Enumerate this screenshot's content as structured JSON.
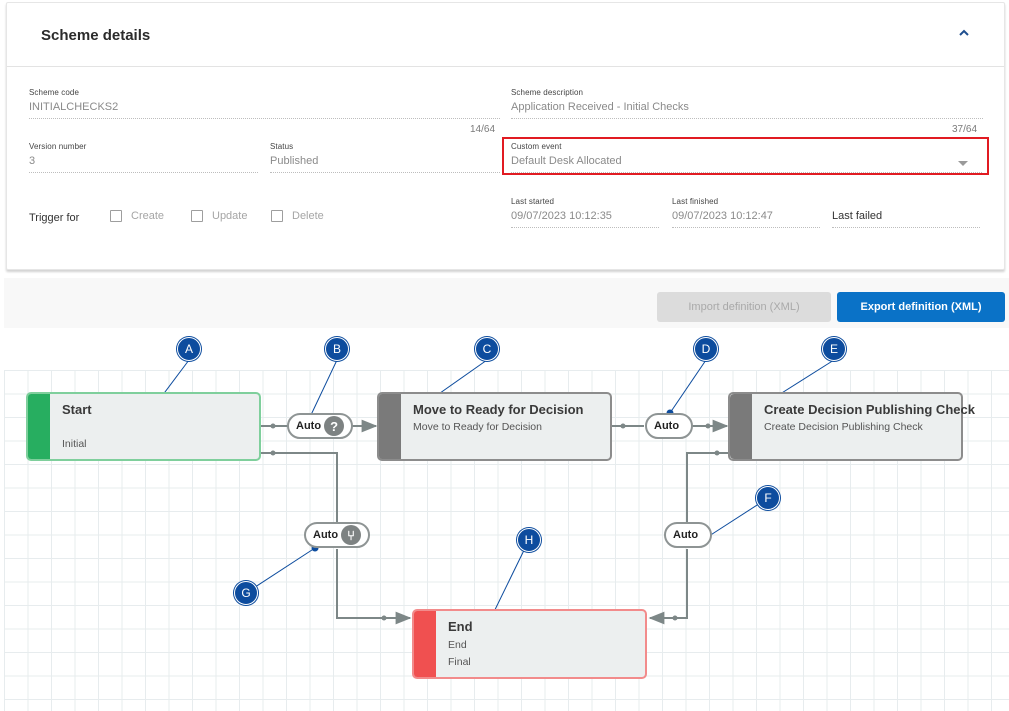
{
  "scheme_details": {
    "title": "Scheme details",
    "collapse_icon": "chevron-up-icon",
    "scheme_code": {
      "label": "Scheme code",
      "value": "INITIALCHECKS2",
      "counter": "14/64"
    },
    "scheme_description": {
      "label": "Scheme description",
      "value": "Application Received - Initial Checks",
      "counter": "37/64"
    },
    "version_number": {
      "label": "Version number",
      "value": "3"
    },
    "status": {
      "label": "Status",
      "value": "Published"
    },
    "custom_event": {
      "label": "Custom event",
      "value": "Default Desk Allocated",
      "highlight_color": "#e11b22"
    },
    "trigger_for": {
      "label": "Trigger for",
      "options": [
        {
          "label": "Create",
          "checked": false
        },
        {
          "label": "Update",
          "checked": false
        },
        {
          "label": "Delete",
          "checked": false
        }
      ]
    },
    "last_started": {
      "label": "Last started",
      "value": "09/07/2023 10:12:35"
    },
    "last_finished": {
      "label": "Last finished",
      "value": "09/07/2023 10:12:47"
    },
    "last_failed": {
      "label": "Last failed",
      "value": ""
    }
  },
  "toolbar": {
    "import_label": "Import definition (XML)",
    "export_label": "Export definition (XML)",
    "export_color": "#0a72c7"
  },
  "diagram": {
    "nodes": [
      {
        "id": "start",
        "title": "Start",
        "lines": [
          "Initial"
        ],
        "stripe_color": "#27ae60",
        "border_color": "#7fcf9c"
      },
      {
        "id": "move-ready",
        "title": "Move to Ready for Decision",
        "lines": [
          "Move to Ready for Decision"
        ],
        "stripe_color": "#7a7a7a",
        "border_color": "#8c8c8c"
      },
      {
        "id": "create-check",
        "title": "Create Decision Publishing Check",
        "lines": [
          "Create Decision Publishing Check"
        ],
        "stripe_color": "#7a7a7a",
        "border_color": "#8c8c8c"
      },
      {
        "id": "end",
        "title": "End",
        "lines": [
          "End",
          "Final"
        ],
        "stripe_color": "#f05050",
        "border_color": "#f28b8b"
      }
    ],
    "transitions": [
      {
        "id": "t-start-move",
        "label": "Auto",
        "icon": "question-icon",
        "icon_glyph": "?"
      },
      {
        "id": "t-move-create",
        "label": "Auto",
        "icon": "",
        "icon_glyph": ""
      },
      {
        "id": "t-start-end",
        "label": "Auto",
        "icon": "condition-icon",
        "icon_glyph": "⑂"
      },
      {
        "id": "t-create-end",
        "label": "Auto",
        "icon": "",
        "icon_glyph": ""
      }
    ],
    "callouts": [
      "A",
      "B",
      "C",
      "D",
      "E",
      "F",
      "G",
      "H"
    ],
    "callout_color": "#0d4c9e"
  }
}
